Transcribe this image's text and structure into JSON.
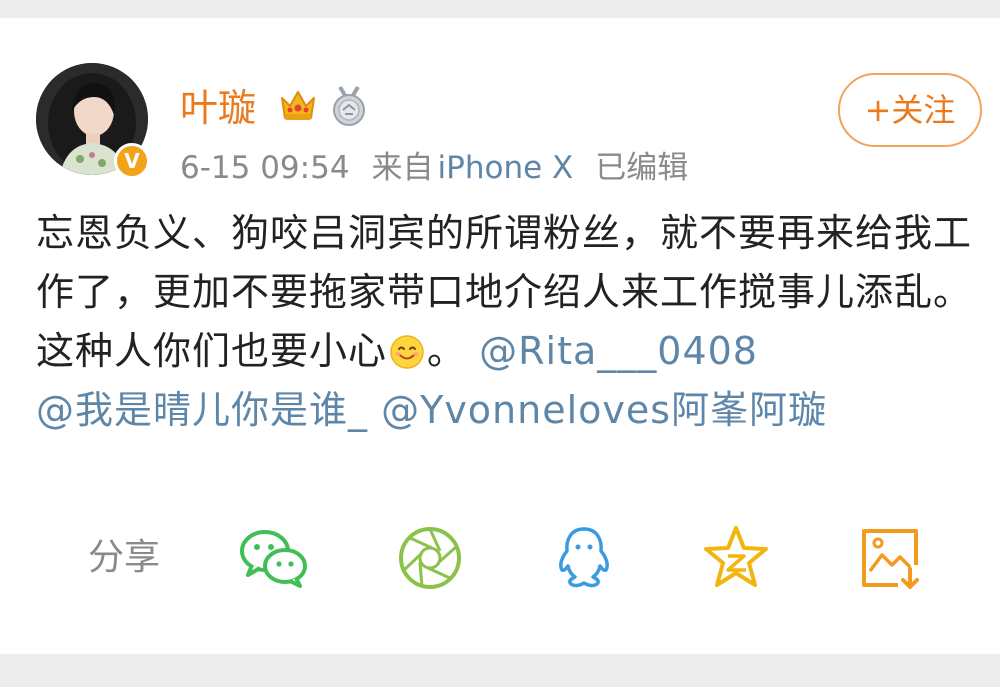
{
  "user": {
    "name": "叶璇",
    "verified_badge": "V",
    "icons": [
      "crown-icon",
      "medal-icon"
    ]
  },
  "meta": {
    "time": "6-15 09:54",
    "source_prefix": "来自",
    "device": "iPhone X",
    "edited": "已编辑"
  },
  "follow_button": {
    "label": "+关注"
  },
  "post": {
    "text": "忘恩负义、狗咬吕洞宾的所谓粉丝，就不要再来给我工作了，更加不要拖家带口地介绍人来工作搅事儿添乱。这种人你们也要小心",
    "after_emoji": "。",
    "emoji": "smile-emoji",
    "mentions": [
      "@Rita___0408",
      "@我是晴儿你是谁_",
      "@Yvonneloves阿峯阿璇"
    ]
  },
  "share": {
    "label": "分享",
    "targets": [
      "wechat-icon",
      "moments-icon",
      "qq-icon",
      "qzone-icon",
      "save-image-icon"
    ]
  },
  "colors": {
    "name_orange": "#ec7a1d",
    "link_blue": "#5e86a8",
    "meta_gray": "#8a8a8a",
    "wechat_green": "#3fbf56",
    "moments_green": "#8bc34a",
    "qq_blue": "#3a9be0",
    "qzone_yellow": "#f1b60e",
    "save_orange": "#f29b1f"
  }
}
